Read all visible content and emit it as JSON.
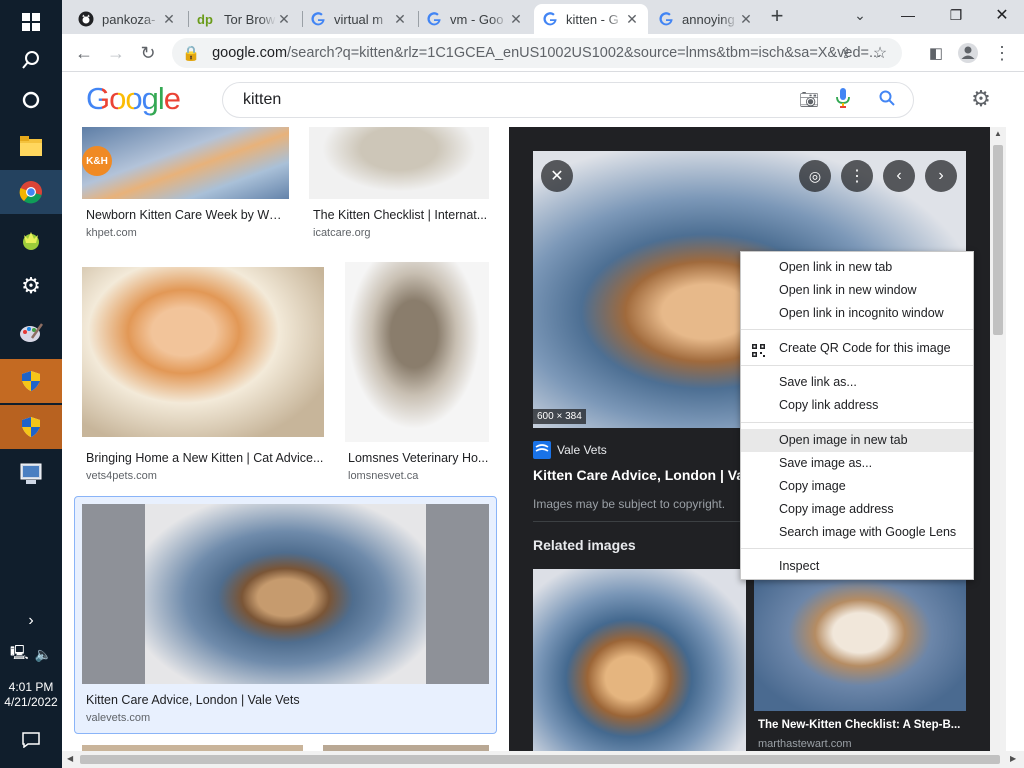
{
  "taskbar": {
    "clock_time": "4:01 PM",
    "clock_date": "4/21/2022"
  },
  "tabs": [
    {
      "title": "pankoza-",
      "favicon": "github-icon"
    },
    {
      "title": "Tor Brow",
      "favicon": "dp-icon"
    },
    {
      "title": "virtual m",
      "favicon": "google-icon"
    },
    {
      "title": "vm - Goo",
      "favicon": "google-icon"
    },
    {
      "title": "kitten - G",
      "favicon": "google-icon",
      "active": true
    },
    {
      "title": "annoying",
      "favicon": "google-icon"
    }
  ],
  "omnibox": {
    "host": "google.com",
    "rest": "/search?q=kitten&rlz=1C1GCEA_enUS1002US1002&source=lnms&tbm=isch&sa=X&ved=..."
  },
  "search": {
    "query": "kitten",
    "logo": "Google"
  },
  "results": [
    {
      "title": "Newborn Kitten Care Week by Wee...",
      "site": "khpet.com"
    },
    {
      "title": "The Kitten Checklist | Internat...",
      "site": "icatcare.org"
    },
    {
      "title": "Bringing Home a New Kitten | Cat Advice...",
      "site": "vets4pets.com"
    },
    {
      "title": "Lomsnes Veterinary Ho...",
      "site": "lomsnesvet.ca"
    },
    {
      "title": "Kitten Care Advice, London | Vale Vets",
      "site": "valevets.com"
    }
  ],
  "thumb_badge": "K&H",
  "panel": {
    "dimensions": "600 × 384",
    "source": "Vale Vets",
    "title": "Kitten Care Advice, London | Va",
    "copyright": "Images may be subject to copyright.",
    "related_heading": "Related images",
    "related": [
      {
        "title": "The New-Kitten Checklist: A Step-B...",
        "site": "marthastewart.com"
      }
    ]
  },
  "context_menu": {
    "groups": [
      [
        "Open link in new tab",
        "Open link in new window",
        "Open link in incognito window"
      ],
      [
        "Create QR Code for this image"
      ],
      [
        "Save link as...",
        "Copy link address"
      ],
      [
        "Open image in new tab",
        "Save image as...",
        "Copy image",
        "Copy image address",
        "Search image with Google Lens"
      ],
      [
        "Inspect"
      ]
    ],
    "highlighted": "Open image in new tab"
  },
  "colors": {
    "taskbar": "#101e2c",
    "panel_bg": "#202124",
    "accent_blue": "#4285f4",
    "selection": "#8ab4f8"
  }
}
